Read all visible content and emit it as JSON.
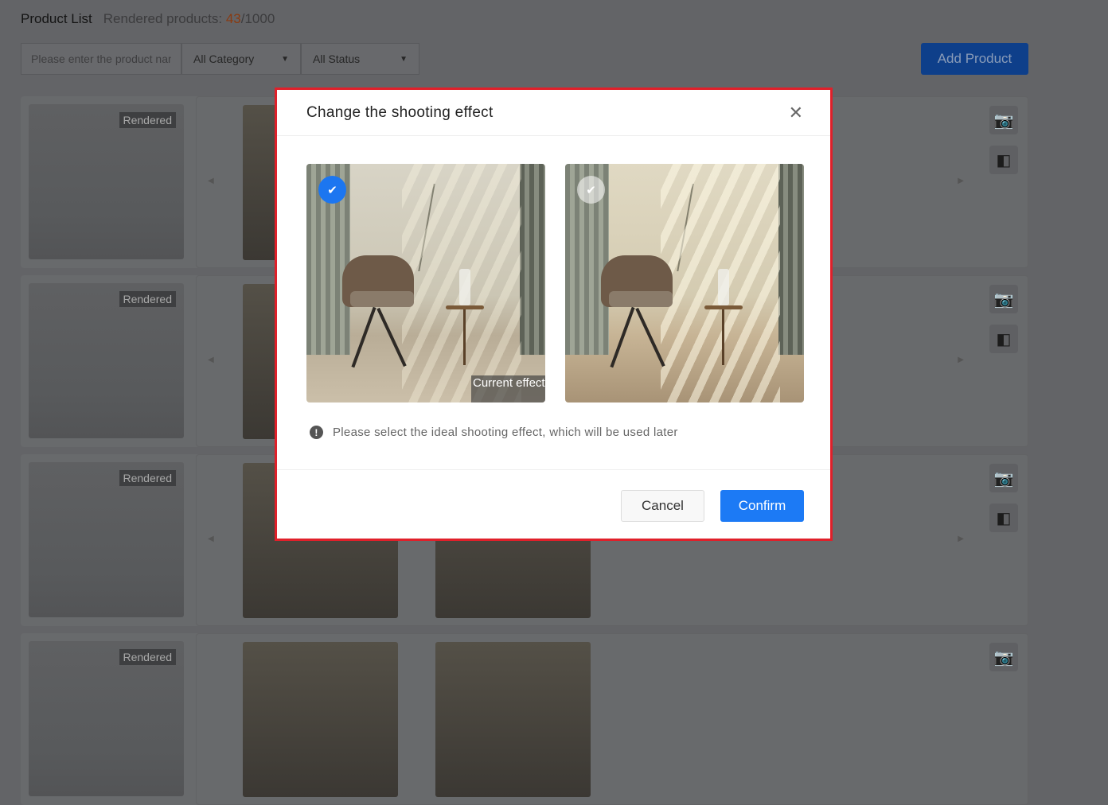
{
  "header": {
    "title": "Product List",
    "rendered_label": "Rendered products: ",
    "rendered_count": "43",
    "rendered_total": "/1000"
  },
  "filters": {
    "search_placeholder": "Please enter the product name",
    "category": "All Category",
    "status": "All Status"
  },
  "add_product_label": "Add Product",
  "rows": [
    {
      "badge": "Rendered"
    },
    {
      "badge": "Rendered"
    },
    {
      "badge": "Rendered"
    },
    {
      "badge": "Rendered"
    }
  ],
  "modal": {
    "title": "Change the shooting effect",
    "options": [
      {
        "selected": true,
        "caption": "Current effect"
      },
      {
        "selected": false
      }
    ],
    "info": "Please select the ideal shooting effect, which will be used later",
    "cancel": "Cancel",
    "confirm": "Confirm"
  },
  "colors": {
    "accent": "#1c7af5",
    "highlight": "#e0202a",
    "count": "#e0641c"
  }
}
